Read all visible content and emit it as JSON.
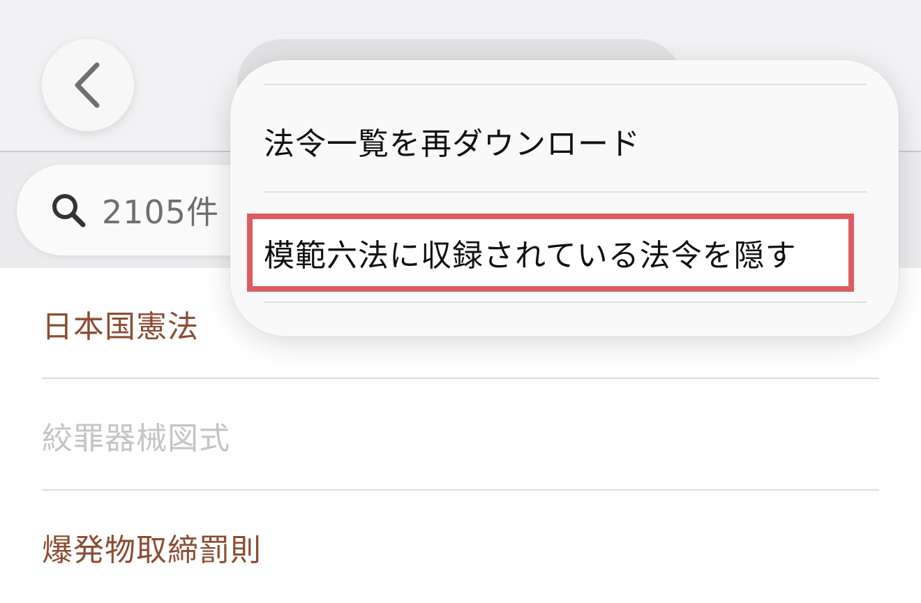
{
  "header": {
    "back_icon": "chevron-left-icon"
  },
  "search": {
    "icon": "magnifying-glass-icon",
    "count": "2105件"
  },
  "laws": [
    {
      "name": "日本国憲法",
      "state": "active"
    },
    {
      "name": "絞罪器械図式",
      "state": "inactive"
    },
    {
      "name": "爆発物取締罰則",
      "state": "active"
    }
  ],
  "menu": {
    "items": [
      {
        "label": "法令一覧を再ダウンロード"
      },
      {
        "label": "模範六法に収録されている法令を隠す",
        "highlighted": true
      }
    ]
  },
  "colors": {
    "law_active": "#8a4d34",
    "law_inactive": "#c4c4c7",
    "highlight_border": "#db5d63"
  }
}
